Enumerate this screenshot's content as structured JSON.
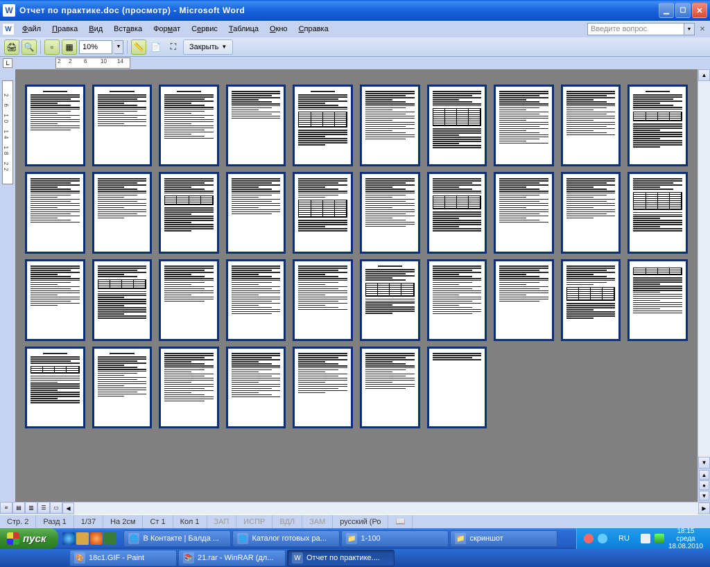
{
  "title": "Отчет по практике.doc (просмотр) - Microsoft Word",
  "menu": {
    "file": "Файл",
    "edit": "Правка",
    "view": "Вид",
    "insert": "Вставка",
    "format": "Формат",
    "tools": "Сервис",
    "table": "Таблица",
    "window": "Окно",
    "help": "Справка"
  },
  "askbox": "Введите вопрос",
  "toolbar": {
    "zoom": "10%",
    "close": "Закрыть"
  },
  "hruler": [
    "2",
    "2",
    "6",
    "10",
    "14"
  ],
  "vruler": "2 6 10 14 18 22",
  "status": {
    "page": "Стр. 2",
    "section": "Разд 1",
    "pages": "1/37",
    "at": "На 2см",
    "line": "Ст 1",
    "col": "Кол 1",
    "rec": "ЗАП",
    "trk": "ИСПР",
    "ext": "ВДЛ",
    "ovr": "ЗАМ",
    "lang": "русский (Ро"
  },
  "start": "пуск",
  "tasks_row1": [
    {
      "label": "В Контакте | Балда ...",
      "icon": "🌐"
    },
    {
      "label": "Каталог готовых ра...",
      "icon": "🌐"
    },
    {
      "label": "1-100",
      "icon": "📁"
    },
    {
      "label": "скриншот",
      "icon": "📁"
    }
  ],
  "tasks_row2": [
    {
      "label": "18c1.GIF - Paint",
      "icon": "🎨"
    },
    {
      "label": "21.rar - WinRAR (дл...",
      "icon": "📚"
    },
    {
      "label": "Отчет по практике....",
      "icon": "W",
      "active": true
    }
  ],
  "tray": {
    "lang": "RU",
    "time": "18:15",
    "day": "среда",
    "date": "18.08.2010"
  },
  "pages": [
    {
      "t": "hd",
      "lines": 18
    },
    {
      "t": "hd",
      "lines": 16
    },
    {
      "t": "hd",
      "lines": 22
    },
    {
      "lines": 14
    },
    {
      "t": "hd",
      "lines": 8,
      "table": 7,
      "after": 8
    },
    {
      "lines": 24
    },
    {
      "lines": 8,
      "table": 8,
      "after": 10
    },
    {
      "lines": 26
    },
    {
      "lines": 22
    },
    {
      "t": "hd",
      "lines": 8,
      "table": 4,
      "after": 12
    },
    {
      "lines": 22
    },
    {
      "lines": 20
    },
    {
      "lines": 8,
      "table": 4,
      "after": 12
    },
    {
      "lines": 18
    },
    {
      "lines": 10,
      "table": 8,
      "after": 6
    },
    {
      "lines": 24
    },
    {
      "lines": 8,
      "table": 6,
      "after": 10
    },
    {
      "lines": 22
    },
    {
      "lines": 20
    },
    {
      "lines": 6,
      "table": 8,
      "after": 10
    },
    {
      "lines": 20
    },
    {
      "lines": 6,
      "table": 4,
      "after": 14
    },
    {
      "lines": 18
    },
    {
      "lines": 24
    },
    {
      "lines": 22
    },
    {
      "t": "hd",
      "lines": 6,
      "table": 6,
      "after": 8
    },
    {
      "lines": 24
    },
    {
      "lines": 18
    },
    {
      "lines": 10,
      "table": 6,
      "after": 8
    },
    {
      "table": 3,
      "after": 18
    },
    {
      "t": "hd",
      "lines": 4,
      "table": 3,
      "after": 14
    },
    {
      "t": "hd",
      "lines": 20
    },
    {
      "lines": 24
    },
    {
      "lines": 22
    },
    {
      "lines": 20
    },
    {
      "lines": 18
    },
    {
      "lines": 4
    }
  ]
}
